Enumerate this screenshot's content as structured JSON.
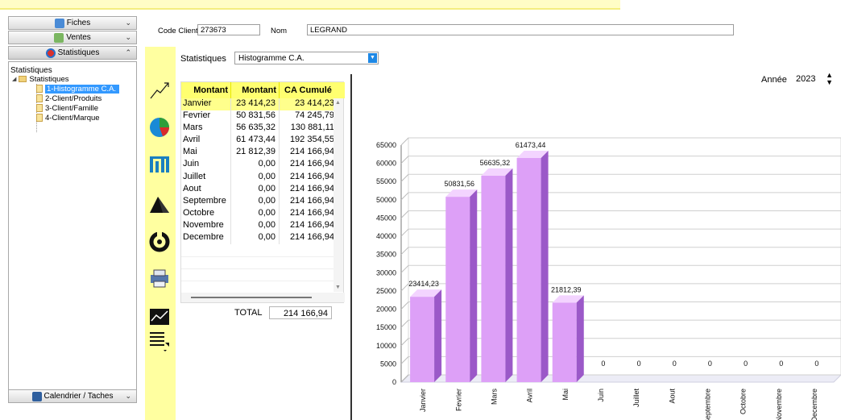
{
  "nav": {
    "buttons": [
      {
        "label": "Fiches",
        "icon": "fiches-icon"
      },
      {
        "label": "Ventes",
        "icon": "ventes-icon"
      },
      {
        "label": "Statistiques",
        "icon": "statistiques-icon"
      }
    ],
    "panel_title": "Statistiques",
    "tree_root": "Statistiques",
    "tree_items": [
      "1-Histogramme C.A.",
      "2-Client/Produits",
      "3-Client/Famille",
      "4-Client/Marque"
    ],
    "bottom_button": "Calendrier / Taches"
  },
  "header": {
    "code_label": "Code Client",
    "code_value": "273673",
    "nom_label": "Nom",
    "nom_value": "LEGRAND"
  },
  "stats": {
    "label": "Statistiques",
    "selected": "Histogramme C.A."
  },
  "table": {
    "headers": [
      "Montant",
      "Montant",
      "CA Cumulé"
    ],
    "rows": [
      {
        "mois": "Janvier",
        "montant": "23 414,23",
        "cumul": "23 414,23"
      },
      {
        "mois": "Fevrier",
        "montant": "50 831,56",
        "cumul": "74 245,79"
      },
      {
        "mois": "Mars",
        "montant": "56 635,32",
        "cumul": "130 881,11"
      },
      {
        "mois": "Avril",
        "montant": "61 473,44",
        "cumul": "192 354,55"
      },
      {
        "mois": "Mai",
        "montant": "21 812,39",
        "cumul": "214 166,94"
      },
      {
        "mois": "Juin",
        "montant": "0,00",
        "cumul": "214 166,94"
      },
      {
        "mois": "Juillet",
        "montant": "0,00",
        "cumul": "214 166,94"
      },
      {
        "mois": "Aout",
        "montant": "0,00",
        "cumul": "214 166,94"
      },
      {
        "mois": "Septembre",
        "montant": "0,00",
        "cumul": "214 166,94"
      },
      {
        "mois": "Octobre",
        "montant": "0,00",
        "cumul": "214 166,94"
      },
      {
        "mois": "Novembre",
        "montant": "0,00",
        "cumul": "214 166,94"
      },
      {
        "mois": "Decembre",
        "montant": "0,00",
        "cumul": "214 166,94"
      }
    ],
    "total_label": "TOTAL",
    "total_value": "214 166,94"
  },
  "year": {
    "label": "Année",
    "value": "2023"
  },
  "chart_data": {
    "type": "bar",
    "categories": [
      "Janvier",
      "Fevrier",
      "Mars",
      "Avril",
      "Mai",
      "Juin",
      "Juillet",
      "Aout",
      "Septembre",
      "Octobre",
      "Novembre",
      "Decembre"
    ],
    "values": [
      23414.23,
      50831.56,
      56635.32,
      61473.44,
      21812.39,
      0,
      0,
      0,
      0,
      0,
      0,
      0
    ],
    "value_labels": [
      "23414,23",
      "50831,56",
      "56635,32",
      "61473,44",
      "21812,39",
      "0",
      "0",
      "0",
      "0",
      "0",
      "0",
      "0"
    ],
    "ylim": [
      0,
      65000
    ],
    "yticks": [
      0,
      5000,
      10000,
      15000,
      20000,
      25000,
      30000,
      35000,
      40000,
      45000,
      50000,
      55000,
      60000,
      65000
    ],
    "grid": true,
    "bar_color": "#dda0f7",
    "bar_side_color": "#9b59c8"
  }
}
